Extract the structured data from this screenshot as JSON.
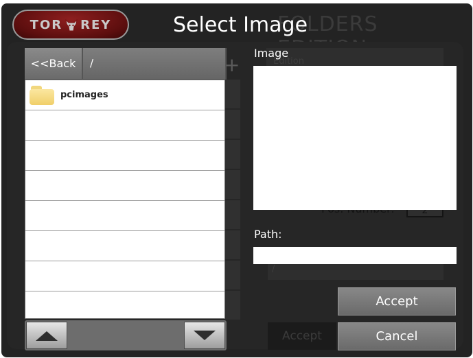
{
  "header": {
    "logo_text_left": "TOR",
    "logo_text_right": "REY",
    "title": "Select Image",
    "background_title": "FOLDERS EDITION"
  },
  "background": {
    "edition_field": "Edition",
    "pos_number_label": "Pos. Number:",
    "pos_number_value": "2",
    "path_value": "/",
    "accept_label": "Accept",
    "add_icon": "+"
  },
  "browser": {
    "back_label": "<<Back",
    "current_path": "/",
    "items": [
      {
        "name": "pcimages",
        "type": "folder",
        "icon": "folder-icon"
      }
    ],
    "empty_rows": 7,
    "scroll_up_icon": "triangle-up-icon",
    "scroll_down_icon": "triangle-down-icon"
  },
  "preview": {
    "label": "Image"
  },
  "path": {
    "label": "Path:",
    "value": ""
  },
  "actions": {
    "accept_label": "Accept",
    "cancel_label": "Cancel"
  },
  "colors": {
    "app_background": "#232323",
    "panel": "#262626",
    "logo_red": "#7a1515",
    "folder_yellow": "#f5d77d",
    "button_gray": "#7a7a7a"
  }
}
